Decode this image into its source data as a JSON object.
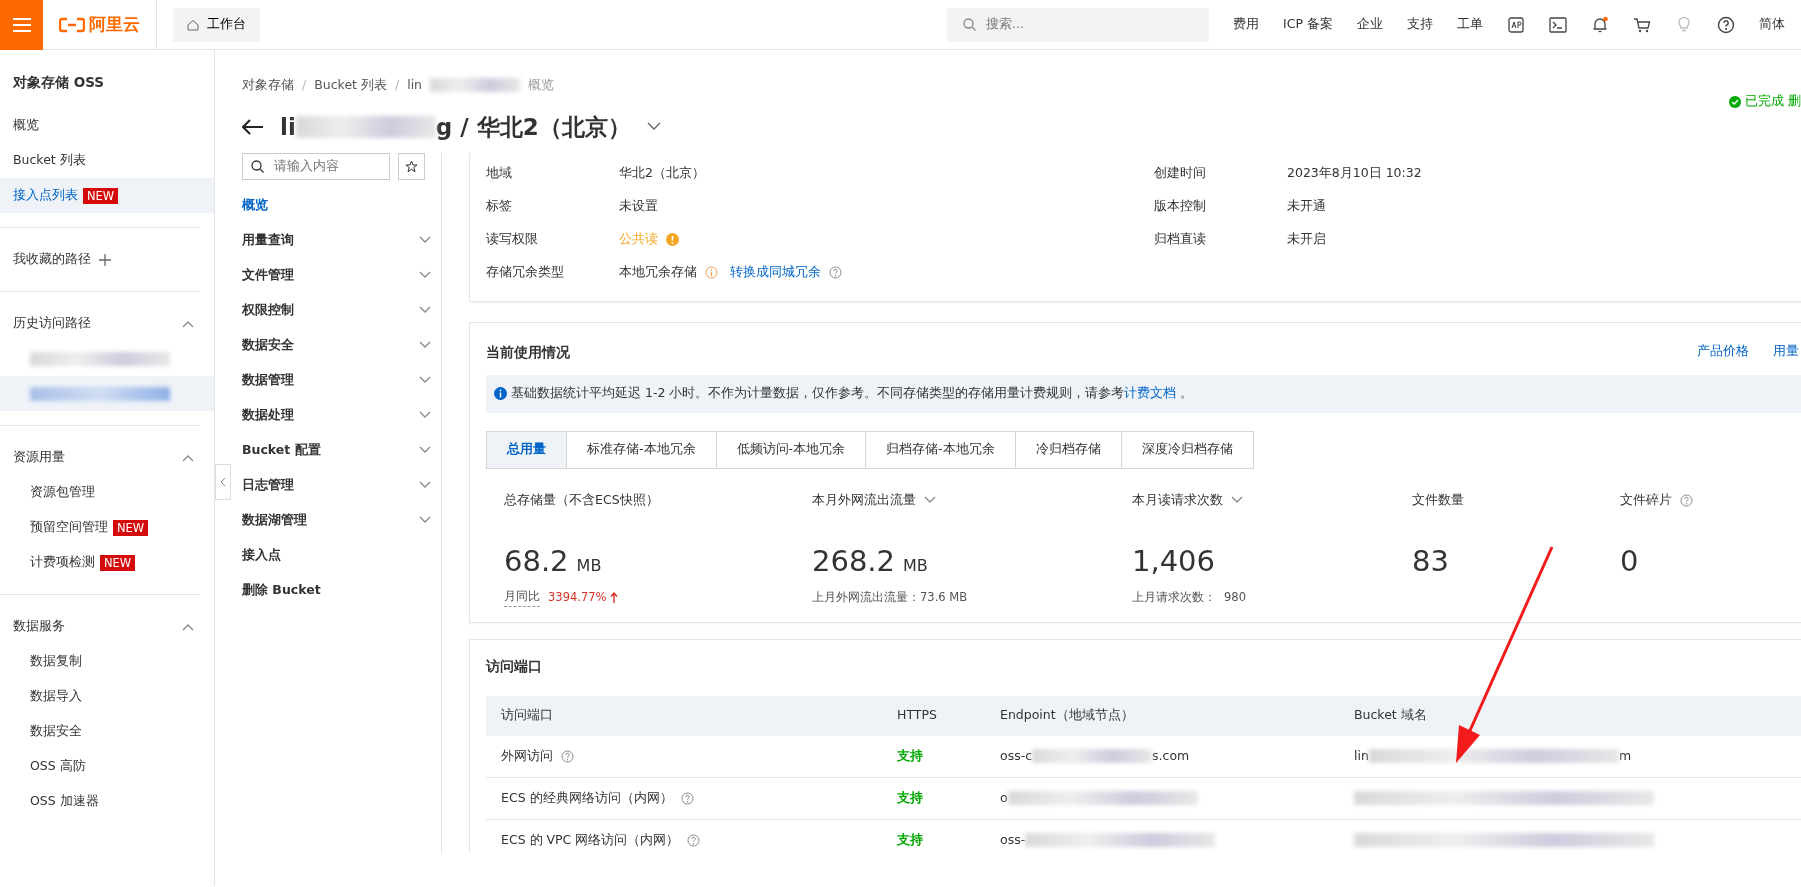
{
  "topbar": {
    "logo": "阿里云",
    "workbench": "工作台",
    "search": {
      "placeholder": "搜索..."
    },
    "links": [
      "费用",
      "ICP 备案",
      "企业",
      "支持",
      "工单"
    ],
    "notification": true,
    "language": "简体"
  },
  "sidebar": {
    "title": "对象存储 OSS",
    "groups": [
      {
        "items": [
          {
            "label": "概览",
            "selected": false
          },
          {
            "label": "Bucket 列表",
            "selected": false
          },
          {
            "label": "接入点列表",
            "badge": "NEW",
            "selected": true
          }
        ]
      },
      {
        "title": "我收藏的路径",
        "kind": "add"
      },
      {
        "title": "历史访问路径",
        "kind": "collapsible",
        "expanded": true,
        "items": [
          {
            "kind": "redacted",
            "selected": false
          },
          {
            "kind": "redacted",
            "selected": true
          }
        ]
      },
      {
        "title": "资源用量",
        "kind": "collapsible",
        "expanded": true,
        "items": [
          {
            "label": "资源包管理",
            "selected": false
          },
          {
            "label": "预留空间管理",
            "badge": "NEW",
            "selected": false
          },
          {
            "label": "计费项检测",
            "badge": "NEW",
            "selected": false
          }
        ]
      },
      {
        "title": "数据服务",
        "kind": "collapsible",
        "expanded": true,
        "items": [
          {
            "label": "数据复制",
            "selected": false
          },
          {
            "label": "数据导入",
            "selected": false
          },
          {
            "label": "数据安全",
            "selected": false
          },
          {
            "label": "OSS 高防",
            "selected": false
          },
          {
            "label": "OSS 加速器",
            "selected": false
          }
        ]
      }
    ]
  },
  "breadcrumb": {
    "separator": "/",
    "items": [
      {
        "label": "对象存储"
      },
      {
        "label": "Bucket 列表"
      },
      {
        "label": "lin",
        "redacted": true
      },
      {
        "label": "概览"
      }
    ]
  },
  "title": {
    "prefix": "li",
    "suffix": "g / 华北2（北京）"
  },
  "status": "已完成 删",
  "bucket_nav": {
    "search": {
      "placeholder": "请输入内容"
    },
    "items": [
      {
        "label": "概览",
        "selected": true,
        "expandable": false
      },
      {
        "label": "用量查询",
        "selected": false,
        "expandable": true
      },
      {
        "label": "文件管理",
        "selected": false,
        "expandable": true
      },
      {
        "label": "权限控制",
        "selected": false,
        "expandable": true
      },
      {
        "label": "数据安全",
        "selected": false,
        "expandable": true
      },
      {
        "label": "数据管理",
        "selected": false,
        "expandable": true
      },
      {
        "label": "数据处理",
        "selected": false,
        "expandable": true
      },
      {
        "label": "Bucket 配置",
        "selected": false,
        "expandable": true
      },
      {
        "label": "日志管理",
        "selected": false,
        "expandable": true
      },
      {
        "label": "数据湖管理",
        "selected": false,
        "expandable": true
      },
      {
        "label": "接入点",
        "selected": false,
        "expandable": false
      },
      {
        "label": "删除 Bucket",
        "selected": false,
        "expandable": false
      }
    ]
  },
  "details": [
    [
      {
        "label": "地域",
        "value": "华北2（北京）"
      },
      {
        "label": "创建时间",
        "value": "2023年8月10日 10:32"
      }
    ],
    [
      {
        "label": "标签",
        "value": "未设置"
      },
      {
        "label": "版本控制",
        "value": "未开通"
      }
    ],
    [
      {
        "label": "读写权限",
        "value": "公共读",
        "kind": "warning"
      },
      {
        "label": "归档直读",
        "value": "未开启"
      }
    ],
    [
      {
        "label": "存储冗余类型",
        "value": "本地冗余存储",
        "kind": "info",
        "link": "转换成同城冗余"
      }
    ]
  ],
  "usage": {
    "title": "当前使用情况",
    "links": [
      "产品价格",
      "用量"
    ],
    "notice": "基础数据统计平均延迟 1-2 小时。不作为计量数据，仅作参考。不同存储类型的存储用量计费规则，请参考",
    "notice_link": "计费文档",
    "notice_end": "。",
    "tabs": [
      {
        "label": "总用量",
        "selected": true
      },
      {
        "label": "标准存储-本地冗余",
        "selected": false
      },
      {
        "label": "低频访问-本地冗余",
        "selected": false
      },
      {
        "label": "归档存储-本地冗余",
        "selected": false
      },
      {
        "label": "冷归档存储",
        "selected": false
      },
      {
        "label": "深度冷归档存储",
        "selected": false
      }
    ],
    "stats": [
      {
        "label": "总存储量（不含ECS快照）",
        "value": "68.2",
        "unit": "MB",
        "sub_label": "月同比",
        "sub_value": "3394.77%",
        "rising": true
      },
      {
        "label": "本月外网流出流量",
        "dropdown": true,
        "value": "268.2",
        "unit": "MB",
        "sub_label": "上月外网流出流量：73.6 MB"
      },
      {
        "label": "本月读请求次数",
        "dropdown": true,
        "value": "1,406",
        "sub_label": "上月请求次数：",
        "sub_value": "980"
      },
      {
        "label": "文件数量",
        "value": "83"
      },
      {
        "label": "文件碎片",
        "help": true,
        "value": "0"
      }
    ]
  },
  "endpoints": {
    "title": "访问端口",
    "columns": [
      "访问端口",
      "HTTPS",
      "Endpoint（地域节点）",
      "Bucket 域名"
    ],
    "rows": [
      {
        "name": "外网访问",
        "https": "支持",
        "endpoint_prefix": "oss-c",
        "endpoint_suffix": "s.com",
        "domain_prefix": "lin",
        "domain_suffix": "m"
      },
      {
        "name": "ECS 的经典网络访问（内网）",
        "https": "支持",
        "endpoint_prefix": "o"
      },
      {
        "name": "ECS 的 VPC 网络访问（内网）",
        "https": "支持",
        "endpoint_prefix": "oss-"
      }
    ]
  }
}
